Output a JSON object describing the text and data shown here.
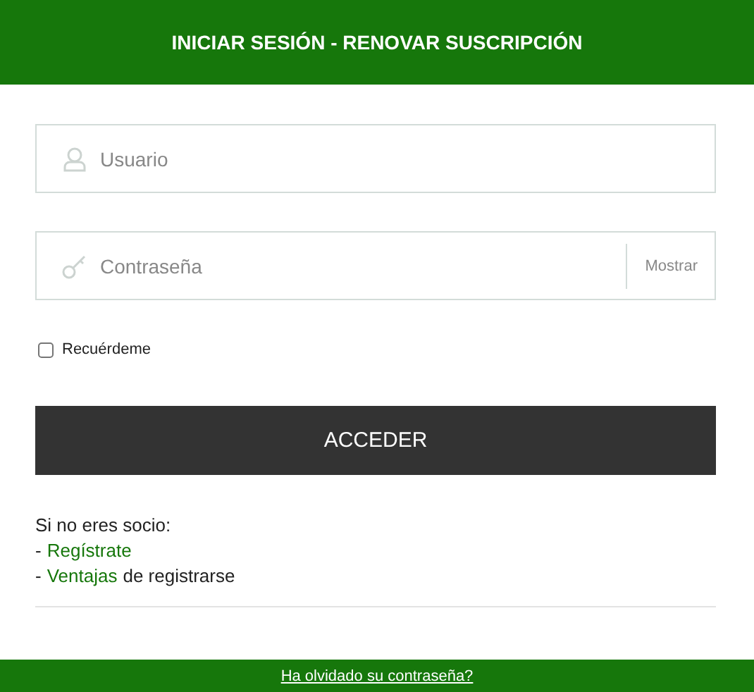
{
  "header": {
    "title": "INICIAR SESIÓN - RENOVAR SUSCRIPCIÓN"
  },
  "fields": [
    {
      "kind": "user",
      "placeholder": "Usuario"
    },
    {
      "kind": "password",
      "placeholder": "Contraseña",
      "toggle": "Mostrar"
    }
  ],
  "remember": {
    "label": "Recuérdeme",
    "checked": false
  },
  "submit": "ACCEDER",
  "intro": "Si no eres socio:",
  "register_lines": [
    {
      "prefix": "-",
      "link": "Regístrate"
    },
    {
      "prefix": "-",
      "link": "Ventajas",
      "suffix": "de registrarse"
    }
  ],
  "footer": {
    "link": "Ha olvidado su contraseña?"
  }
}
